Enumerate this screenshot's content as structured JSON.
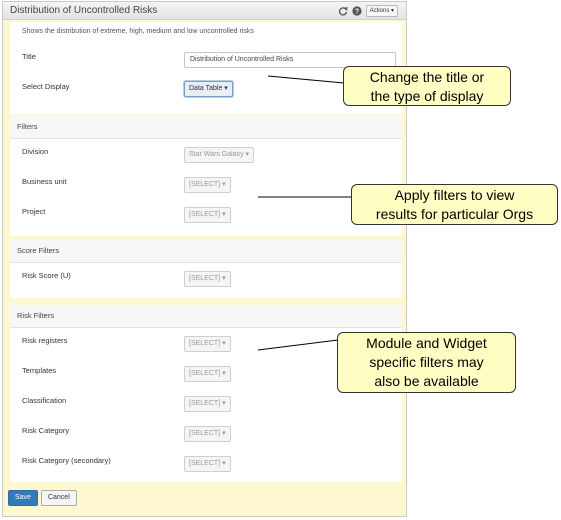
{
  "widget": {
    "title": "Distribution of Uncontrolled Risks",
    "actions_label": "Actions ▾",
    "icons": [
      "refresh-icon",
      "help-icon"
    ]
  },
  "general": {
    "description": "Shows the distribution of extreme, high, medium and low uncontrolled risks",
    "title_label": "Title",
    "title_value": "Distribution of Uncontrolled Risks",
    "display_label": "Select Display",
    "display_value": "Data Table ▾"
  },
  "filters": {
    "heading": "Filters",
    "division_label": "Division",
    "division_value": "Star Wars Galaxy ▾",
    "business_unit_label": "Business unit",
    "business_unit_value": "[SELECT] ▾",
    "project_label": "Project",
    "project_value": "[SELECT] ▾"
  },
  "score_filters": {
    "heading": "Score Filters",
    "risk_score_label": "Risk Score (U)",
    "risk_score_value": "[SELECT] ▾"
  },
  "risk_filters": {
    "heading": "Risk Filters",
    "items": [
      {
        "label": "Risk registers",
        "value": "[SELECT] ▾"
      },
      {
        "label": "Templates",
        "value": "[SELECT] ▾"
      },
      {
        "label": "Classification",
        "value": "[SELECT] ▾"
      },
      {
        "label": "Risk Category",
        "value": "[SELECT] ▾"
      },
      {
        "label": "Risk Category (secondary)",
        "value": "[SELECT] ▾"
      }
    ]
  },
  "buttons": {
    "save": "Save",
    "cancel": "Cancel"
  },
  "callouts": {
    "title_display": [
      "Change the title or",
      "the type of display"
    ],
    "filters": [
      "Apply filters to view",
      "results for particular Orgs"
    ],
    "module": [
      "Module and Widget",
      "specific filters may",
      "also be available"
    ]
  }
}
